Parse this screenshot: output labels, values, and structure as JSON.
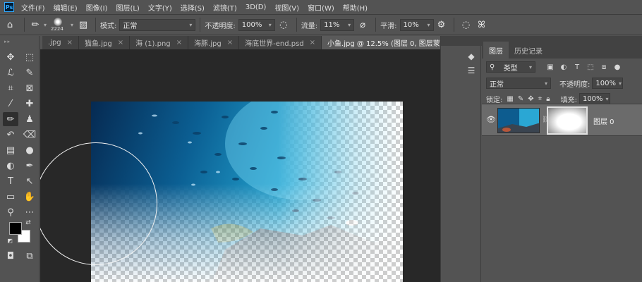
{
  "app": {
    "logo": "Ps"
  },
  "menu": [
    "文件(F)",
    "编辑(E)",
    "图像(I)",
    "图层(L)",
    "文字(Y)",
    "选择(S)",
    "滤镜(T)",
    "3D(D)",
    "视图(V)",
    "窗口(W)",
    "帮助(H)"
  ],
  "options": {
    "brush_size": "2224",
    "mode_label": "模式:",
    "mode_value": "正常",
    "opacity_label": "不透明度:",
    "opacity_value": "100%",
    "flow_label": "流量:",
    "flow_value": "11%",
    "smoothing_label": "平滑:",
    "smoothing_value": "10%"
  },
  "tabs": [
    {
      "label": ".jpg",
      "close": "×"
    },
    {
      "label": "猫鱼.jpg",
      "close": "×"
    },
    {
      "label": "海 (1).png",
      "close": "×"
    },
    {
      "label": "海豚.jpg",
      "close": "×"
    },
    {
      "label": "海底世界-end.psd",
      "close": "×"
    },
    {
      "label": "小鱼.jpg @ 12.5% (图层 0, 图层蒙版/8) *",
      "close": "×"
    }
  ],
  "tab_overflow": "»",
  "tools": [
    {
      "name": "move-tool",
      "icon": "✥"
    },
    {
      "name": "marquee-tool",
      "icon": "⬚"
    },
    {
      "name": "lasso-tool",
      "icon": "ℒ"
    },
    {
      "name": "quick-select-tool",
      "icon": "✎"
    },
    {
      "name": "crop-tool",
      "icon": "⌗"
    },
    {
      "name": "frame-tool",
      "icon": "⊠"
    },
    {
      "name": "eyedropper-tool",
      "icon": "⁄"
    },
    {
      "name": "healing-tool",
      "icon": "✚"
    },
    {
      "name": "brush-tool",
      "icon": "✏"
    },
    {
      "name": "stamp-tool",
      "icon": "♟"
    },
    {
      "name": "history-brush-tool",
      "icon": "↶"
    },
    {
      "name": "eraser-tool",
      "icon": "⌫"
    },
    {
      "name": "gradient-tool",
      "icon": "▤"
    },
    {
      "name": "blur-tool",
      "icon": "●"
    },
    {
      "name": "dodge-tool",
      "icon": "◐"
    },
    {
      "name": "pen-tool",
      "icon": "✒"
    },
    {
      "name": "type-tool",
      "icon": "T"
    },
    {
      "name": "path-select-tool",
      "icon": "↖"
    },
    {
      "name": "shape-tool",
      "icon": "▭"
    },
    {
      "name": "hand-tool",
      "icon": "✋"
    },
    {
      "name": "zoom-tool",
      "icon": "⚲"
    },
    {
      "name": "more-tools",
      "icon": "⋯"
    }
  ],
  "layers_panel": {
    "tab_layers": "图层",
    "tab_history": "历史记录",
    "filter_label": "类型",
    "blend_mode": "正常",
    "opacity_label": "不透明度:",
    "opacity_value": "100%",
    "lock_label": "锁定:",
    "fill_label": "填充:",
    "fill_value": "100%",
    "layer_name": "图层 0"
  }
}
